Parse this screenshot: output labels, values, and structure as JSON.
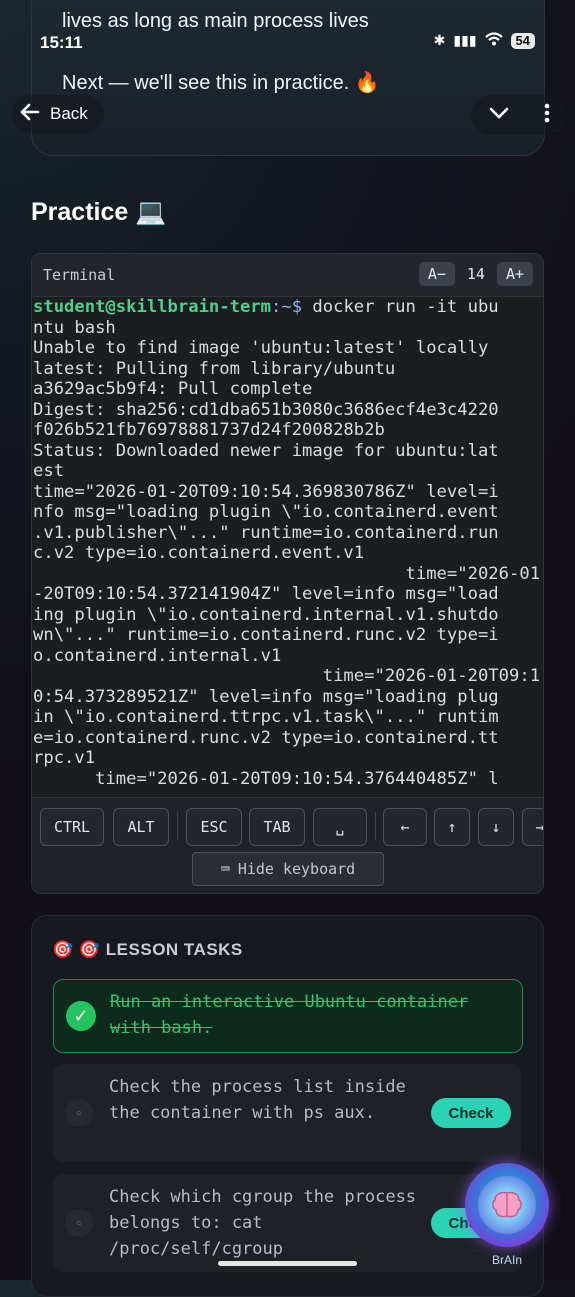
{
  "status_bar": {
    "time": "15:11",
    "battery": "54"
  },
  "intro": {
    "line1": "lives as long as main process lives",
    "line2": "Next — we'll see this in practice. 🔥"
  },
  "nav": {
    "back_label": "Back"
  },
  "section": {
    "title": "Practice 💻"
  },
  "terminal": {
    "title": "Terminal",
    "font_decrease": "A−",
    "font_size": "14",
    "font_increase": "A+",
    "prompt_user": "student@skillbrain-term",
    "prompt_path": ":~$",
    "command": " docker run -it ubu",
    "output_lines": [
      "ntu bash",
      "Unable to find image 'ubuntu:latest' locally",
      "latest: Pulling from library/ubuntu",
      "a3629ac5b9f4: Pull complete",
      "Digest: sha256:cd1dba651b3080c3686ecf4e3c4220",
      "f026b521fb76978881737d24f200828b2b",
      "Status: Downloaded newer image for ubuntu:lat",
      "est",
      "time=\"2026-01-20T09:10:54.369830786Z\" level=i",
      "nfo msg=\"loading plugin \\\"io.containerd.event",
      ".v1.publisher\\\"...\" runtime=io.containerd.run",
      "c.v2 type=io.containerd.event.v1",
      "                                    time=\"2026-01",
      "-20T09:10:54.372141904Z\" level=info msg=\"load",
      "ing plugin \\\"io.containerd.internal.v1.shutdo",
      "wn\\\"...\" runtime=io.containerd.runc.v2 type=i",
      "o.containerd.internal.v1",
      "                            time=\"2026-01-20T09:1",
      "0:54.373289521Z\" level=info msg=\"loading plug",
      "in \\\"io.containerd.ttrpc.v1.task\\\"...\" runtim",
      "e=io.containerd.runc.v2 type=io.containerd.tt",
      "rpc.v1",
      "      time=\"2026-01-20T09:10:54.376440485Z\" l"
    ],
    "keys": [
      "CTRL",
      "ALT",
      "ESC",
      "TAB",
      "␣",
      "←",
      "↑",
      "↓",
      "→"
    ],
    "hide_keyboard": "Hide keyboard"
  },
  "tasks": {
    "title": "🎯 LESSON TASKS",
    "items": [
      {
        "text": "Run an interactive Ubuntu container with bash.",
        "done": true
      },
      {
        "text": "Check the process list inside the container with ps aux.",
        "done": false,
        "button": "Check"
      },
      {
        "text": "Check which cgroup the process belongs to: cat /proc/self/cgroup",
        "done": false,
        "button": "Check"
      }
    ]
  },
  "assistant": {
    "label": "BrAIn"
  }
}
